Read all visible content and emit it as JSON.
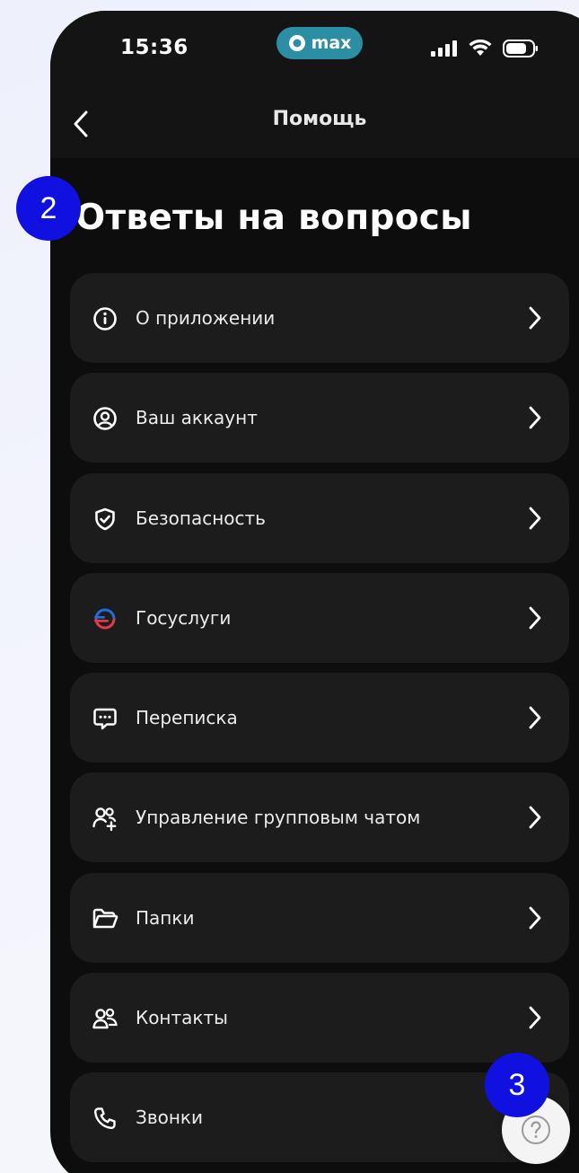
{
  "status_bar": {
    "time": "15:36",
    "app_pill": "max"
  },
  "header": {
    "title": "Помощь",
    "back_icon": "chevron-left-icon"
  },
  "page_title": "Ответы на вопросы",
  "items": [
    {
      "label": "О приложении",
      "icon": "info-icon"
    },
    {
      "label": "Ваш аккаунт",
      "icon": "user-circle-icon"
    },
    {
      "label": "Безопасность",
      "icon": "shield-check-icon"
    },
    {
      "label": "Госуслуги",
      "icon": "gosuslugi-icon"
    },
    {
      "label": "Переписка",
      "icon": "chat-bubble-icon"
    },
    {
      "label": "Управление групповым чатом",
      "icon": "group-add-icon"
    },
    {
      "label": "Папки",
      "icon": "folder-icon"
    },
    {
      "label": "Контакты",
      "icon": "contacts-icon"
    },
    {
      "label": "Звонки",
      "icon": "phone-icon"
    }
  ],
  "badges": {
    "step_2": "2",
    "step_3": "3"
  },
  "colors": {
    "background": "#0d0d0d",
    "card": "#1c1c1c",
    "badge": "#1010e0",
    "pill": "#2c8ea3"
  }
}
